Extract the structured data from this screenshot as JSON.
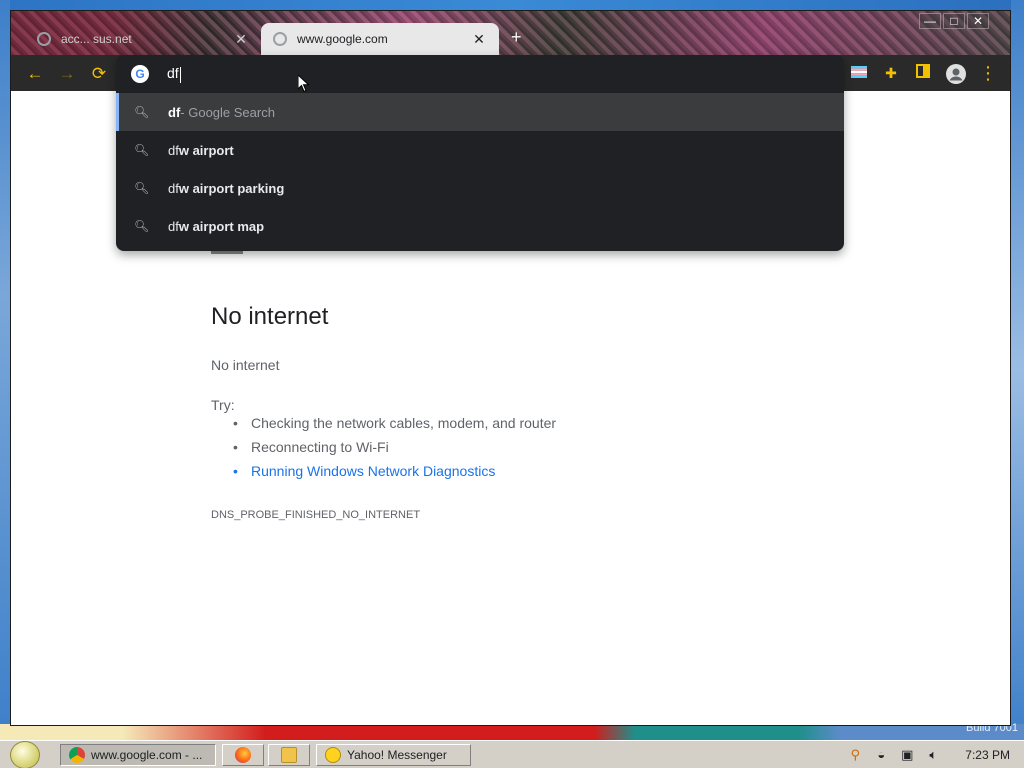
{
  "browser": {
    "tabs": [
      {
        "title": "acc... sus.net"
      },
      {
        "title": "www.google.com"
      }
    ],
    "new_tab": "+",
    "window_controls": {
      "minimize": "—",
      "maximize": "□",
      "close": "✕"
    },
    "toolbar": {
      "back": "←",
      "forward": "→",
      "reload": "⟳",
      "menu": "⋮"
    },
    "omnibox": {
      "value": "df",
      "suggestions": [
        {
          "typed": "df",
          "completion": "",
          "suffix": " - Google Search",
          "selected": true
        },
        {
          "typed": "df",
          "completion": "w airport",
          "suffix": "",
          "selected": false
        },
        {
          "typed": "df",
          "completion": "w airport parking",
          "suffix": "",
          "selected": false
        },
        {
          "typed": "df",
          "completion": "w airport map",
          "suffix": "",
          "selected": false
        }
      ]
    }
  },
  "page": {
    "heading": "No internet",
    "subheading": "No internet",
    "try_label": "Try:",
    "tips": [
      {
        "text": "Checking the network cables, modem, and router",
        "link": false
      },
      {
        "text": "Reconnecting to Wi-Fi",
        "link": false
      },
      {
        "text": "Running Windows Network Diagnostics",
        "link": true
      }
    ],
    "error_code": "DNS_PROBE_FINISHED_NO_INTERNET"
  },
  "taskbar": {
    "tasks": [
      {
        "label": "www.google.com - ...",
        "icon": "chrome-icon",
        "pressed": true
      },
      {
        "label": "",
        "icon": "firefox-icon",
        "pressed": false
      },
      {
        "label": "",
        "icon": "folder-icon",
        "pressed": false
      },
      {
        "label": "Yahoo! Messenger",
        "icon": "yahoo-messenger-icon",
        "pressed": false
      }
    ],
    "clock": "7:23 PM"
  },
  "desktop": {
    "build_text": "Build 7001"
  },
  "colors": {
    "accent_yellow": "#f2c200",
    "link_blue": "#1a73e8",
    "dropdown_bg": "#202124"
  }
}
